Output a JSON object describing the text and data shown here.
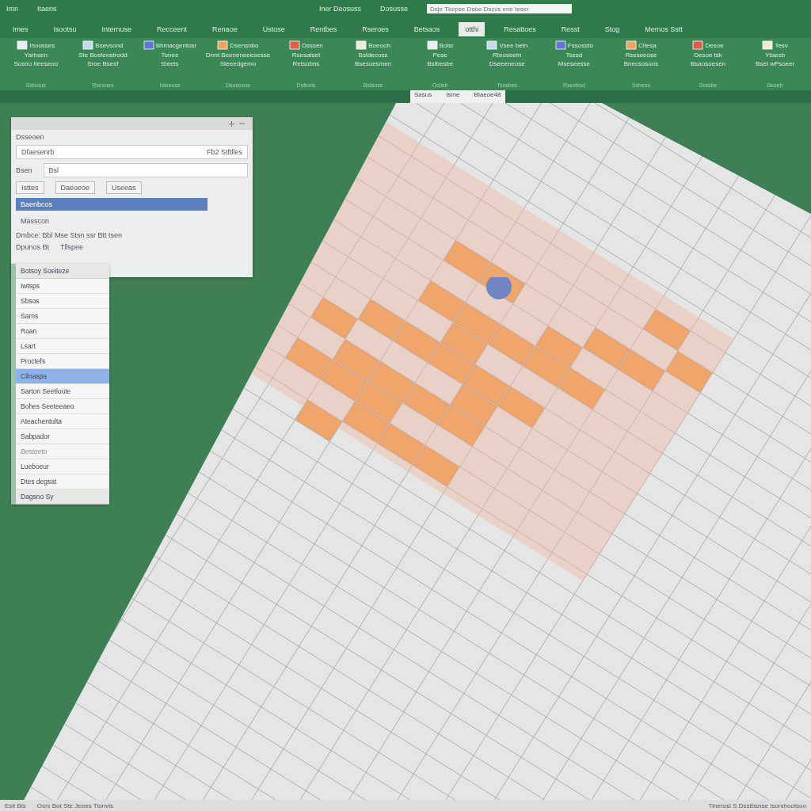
{
  "title_bar": {
    "left_items": [
      "Imn",
      "Itaens"
    ],
    "title": "Iner Deosuss",
    "subtitle": "Dosusse",
    "search": {
      "placeholder": "Dsje Tkepse Dsbe Dscvs ene teser"
    }
  },
  "tabs": [
    {
      "label": "Imes",
      "selected": false
    },
    {
      "label": "Isootsu",
      "selected": false
    },
    {
      "label": "Internuse",
      "selected": false
    },
    {
      "label": "Recceent",
      "selected": false
    },
    {
      "label": "Renaoe",
      "selected": false
    },
    {
      "label": "Ustose",
      "selected": false
    },
    {
      "label": "Rentbes",
      "selected": false
    },
    {
      "label": "Rseroes",
      "selected": false
    },
    {
      "label": "Betsaos",
      "selected": false
    },
    {
      "label": "otthi",
      "selected": true
    },
    {
      "label": "Resattoes",
      "selected": false
    },
    {
      "label": "Resst",
      "selected": false
    },
    {
      "label": "Stog",
      "selected": false
    },
    {
      "label": "Memos Sstt",
      "selected": false
    }
  ],
  "ribbon_groups": [
    {
      "label": "Sstsous",
      "commands": [
        "Ihoosses",
        "Yarhsen",
        "Sosno Iteeseoo"
      ]
    },
    {
      "label": "Rsesnes",
      "commands": [
        "Bsevsond",
        "Ste Bostenstrodd",
        "Sroe Bsesf"
      ]
    },
    {
      "label": "Isteeuss",
      "commands": [
        "Bhmacgentosr",
        "Tonee",
        "Sleets"
      ]
    },
    {
      "label": "Dsosesne",
      "commands": [
        "Dsensnbo",
        "Drmt Beeneneeesesse",
        "Steeedgemo"
      ]
    },
    {
      "label": "Dsttons",
      "commands": [
        "Dsssen",
        "Rsesatset",
        "Retsobns"
      ]
    },
    {
      "label": "Bstsoss",
      "commands": [
        "Boeooh",
        "Bstdecoss",
        "Bsesoesmen"
      ]
    },
    {
      "label": "Oclisb",
      "commands": [
        "Bolsr",
        "Pese",
        "Bslbesbe"
      ]
    },
    {
      "label": "Tsosbes",
      "commands": [
        "Vsee betn",
        "Rteoseetn",
        "Dseeeneose"
      ]
    },
    {
      "label": "Rsesbod",
      "commands": [
        "Fssossto",
        "Tsesd",
        "Mseseesse"
      ]
    },
    {
      "label": "Ssbess",
      "commands": [
        "Cltesa",
        "Rseseeose",
        "Bnecsosoos"
      ]
    },
    {
      "label": "Ssssbe",
      "commands": [
        "Desoe",
        "Desoe tsk",
        "Bsaosoesen"
      ]
    },
    {
      "label": "Bsoeb",
      "commands": [
        "Tesv",
        "Ytaesb",
        "Bset wPsoeer"
      ]
    }
  ],
  "name_box": {
    "cell": "Sasus",
    "column": "Isme",
    "reference": "Blaeoe48"
  },
  "dialog": {
    "label": "Dsseoen",
    "field_value": "Dfaesenrb",
    "field_option": "Fb2 Stftlles",
    "row_label": "Bsen",
    "row_value": "Bsl",
    "tabs": [
      {
        "label": "Isttes",
        "selected": false
      },
      {
        "label": "Daeoeoe",
        "selected": false
      },
      {
        "label": "Useeas",
        "selected": false
      }
    ],
    "rows": [
      {
        "label": "Baenbcos",
        "selected": true
      },
      {
        "label": "Masscon",
        "selected": false
      }
    ],
    "detail_line": "Dmbce:  Bbl   Mse   Stsn ssr Btt tsen",
    "option_label": "Dpunos Bt",
    "option_value": "Tllspee"
  },
  "list_panel": {
    "header": "Botsoy Soeiteze",
    "footer": "Dagsno Sy",
    "items": [
      {
        "label": "Iwtsps",
        "selected": false,
        "disabled": false
      },
      {
        "label": "Sbsos",
        "selected": false,
        "disabled": false
      },
      {
        "label": "Sarns",
        "selected": false,
        "disabled": false
      },
      {
        "label": "Roan",
        "selected": false,
        "disabled": false
      },
      {
        "label": "Lsart",
        "selected": false,
        "disabled": false
      },
      {
        "label": "Proctefs",
        "selected": false,
        "disabled": false
      },
      {
        "label": "Cilnaspa",
        "selected": true,
        "disabled": false
      },
      {
        "label": "Sarton Seetloute",
        "selected": false,
        "disabled": false
      },
      {
        "label": "Bohes Seeteeaeo",
        "selected": false,
        "disabled": false
      },
      {
        "label": "Ateachentulta",
        "selected": false,
        "disabled": false
      },
      {
        "label": "Sabpador",
        "selected": false,
        "disabled": false
      },
      {
        "label": "Besteeto",
        "selected": false,
        "disabled": true
      },
      {
        "label": "Lueboeur",
        "selected": false,
        "disabled": false
      },
      {
        "label": "Dtes degsat",
        "selected": false,
        "disabled": false
      }
    ]
  },
  "status_bar": {
    "left": "Esit Bls",
    "message": "Osrs Bot Ste Jeees Tlonvis",
    "right": "Tlnerosl S Dsstbsnse Isorshootsoo"
  }
}
